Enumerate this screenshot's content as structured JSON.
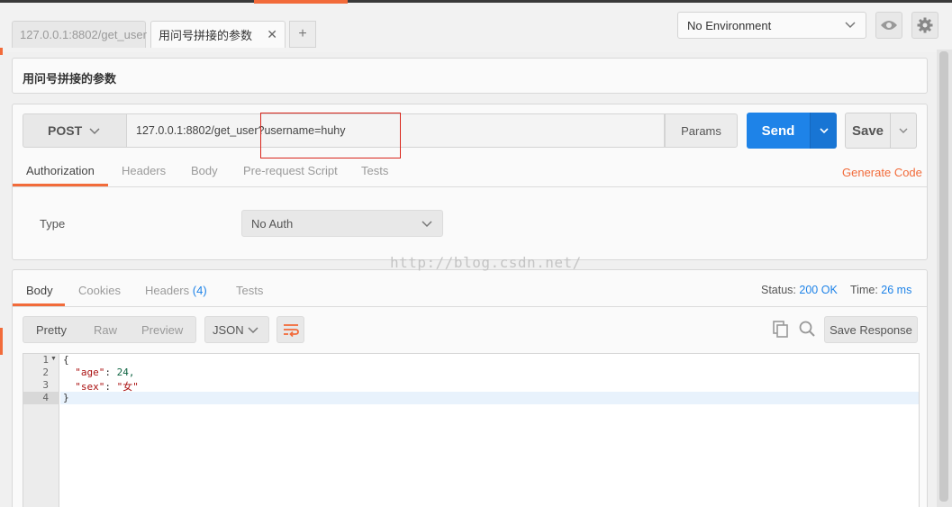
{
  "tabs": [
    {
      "label": "127.0.0.1:8802/get_user",
      "active": false
    },
    {
      "label": "用问号拼接的参数",
      "active": true
    }
  ],
  "tab_add": "+",
  "tab_close": "✕",
  "environment": {
    "selected": "No Environment"
  },
  "request": {
    "name": "用问号拼接的参数",
    "method": "POST",
    "url": "127.0.0.1:8802/get_user?username=huhy",
    "params_label": "Params",
    "send_label": "Send",
    "save_label": "Save"
  },
  "request_tabs": [
    "Authorization",
    "Headers",
    "Body",
    "Pre-request Script",
    "Tests"
  ],
  "generate_code": "Generate Code",
  "auth": {
    "type_label": "Type",
    "selected": "No Auth"
  },
  "watermark": "http://blog.csdn.net/",
  "response_tabs": [
    {
      "label": "Body"
    },
    {
      "label": "Cookies"
    },
    {
      "label": "Headers",
      "count": "(4)"
    },
    {
      "label": "Tests"
    }
  ],
  "status": {
    "label": "Status:",
    "value": "200 OK",
    "time_label": "Time:",
    "time_value": "26 ms"
  },
  "view_modes": [
    "Pretty",
    "Raw",
    "Preview"
  ],
  "format": "JSON",
  "save_response": "Save Response",
  "code_lines": [
    {
      "num": "1",
      "text": "{"
    },
    {
      "num": "2",
      "key": "\"age\"",
      "value": "24,"
    },
    {
      "num": "3",
      "key": "\"sex\"",
      "value": "\"女\""
    },
    {
      "num": "4",
      "text": "}"
    }
  ],
  "colors": {
    "accent": "#f26b3a",
    "primary": "#1e83e8",
    "highlight_box": "#d9261c"
  }
}
